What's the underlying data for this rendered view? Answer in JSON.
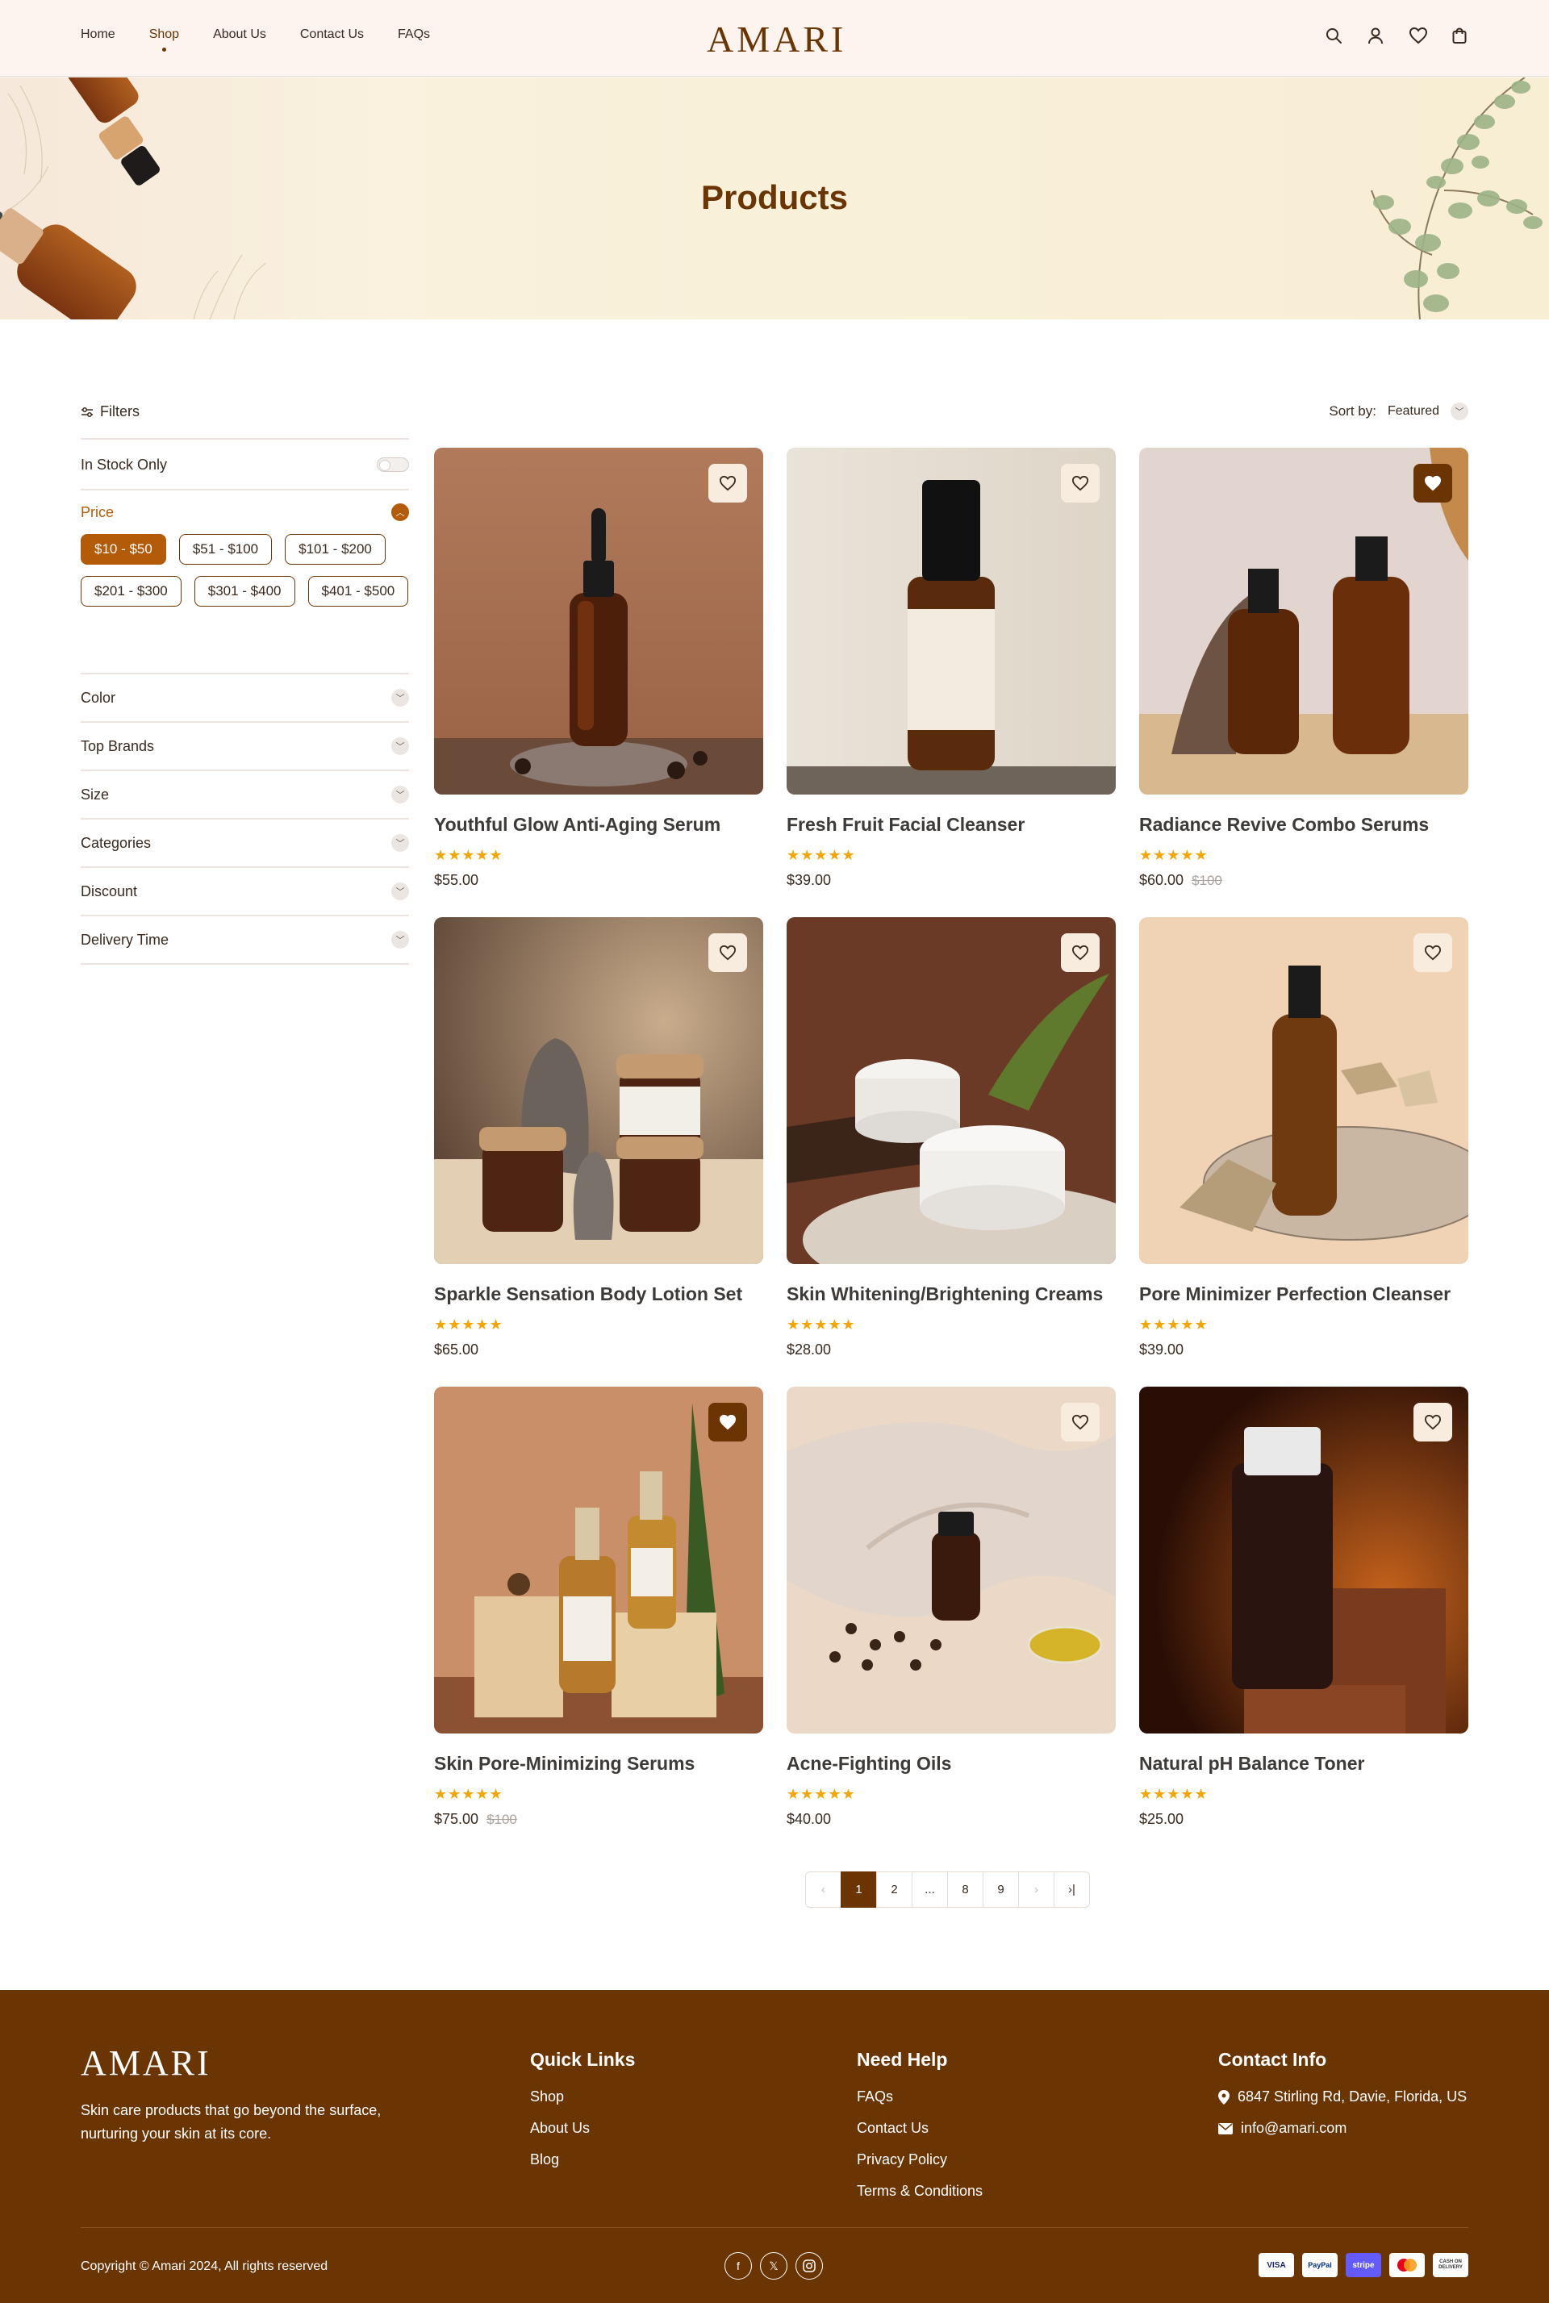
{
  "header": {
    "nav": [
      "Home",
      "Shop",
      "About Us",
      "Contact Us",
      "FAQs"
    ],
    "active_nav": "Shop",
    "logo": "AMARI",
    "icons": [
      "search-icon",
      "user-icon",
      "heart-icon",
      "bag-icon"
    ]
  },
  "hero": {
    "title": "Products"
  },
  "filters": {
    "heading": "Filters",
    "in_stock_label": "In Stock Only",
    "price_label": "Price",
    "price_ranges": [
      "$10 - $50",
      "$51 - $100",
      "$101 - $200",
      "$201 - $300",
      "$301 - $400",
      "$401 - $500"
    ],
    "active_price": "$10 - $50",
    "sections": [
      "Color",
      "Top Brands",
      "Size",
      "Categories",
      "Discount",
      "Delivery Time"
    ]
  },
  "sort": {
    "label": "Sort by:",
    "value": "Featured"
  },
  "products": [
    {
      "name": "Youthful Glow Anti-Aging Serum",
      "price": "$55.00",
      "old_price": "",
      "rating": 5,
      "wishlisted": false
    },
    {
      "name": "Fresh Fruit Facial Cleanser",
      "price": "$39.00",
      "old_price": "",
      "rating": 5,
      "wishlisted": false
    },
    {
      "name": "Radiance Revive Combo Serums",
      "price": "$60.00",
      "old_price": "$100",
      "rating": 5,
      "wishlisted": true
    },
    {
      "name": "Sparkle Sensation Body Lotion Set",
      "price": "$65.00",
      "old_price": "",
      "rating": 5,
      "wishlisted": false
    },
    {
      "name": "Skin Whitening/Brightening Creams",
      "price": "$28.00",
      "old_price": "",
      "rating": 5,
      "wishlisted": false
    },
    {
      "name": "Pore Minimizer Perfection Cleanser",
      "price": "$39.00",
      "old_price": "",
      "rating": 5,
      "wishlisted": false
    },
    {
      "name": "Skin Pore-Minimizing Serums",
      "price": "$75.00",
      "old_price": "$100",
      "rating": 5,
      "wishlisted": true
    },
    {
      "name": "Acne-Fighting Oils",
      "price": "$40.00",
      "old_price": "",
      "rating": 5,
      "wishlisted": false
    },
    {
      "name": "Natural pH Balance Toner",
      "price": "$25.00",
      "old_price": "",
      "rating": 5,
      "wishlisted": false
    }
  ],
  "pagination": {
    "pages": [
      "1",
      "2",
      "...",
      "8",
      "9"
    ],
    "current": "1"
  },
  "footer": {
    "logo": "AMARI",
    "description": "Skin care products that go beyond the surface, nurturing your skin at its core.",
    "quick_links": {
      "title": "Quick Links",
      "items": [
        "Shop",
        "About Us",
        "Blog"
      ]
    },
    "need_help": {
      "title": "Need Help",
      "items": [
        "FAQs",
        "Contact Us",
        "Privacy Policy",
        "Terms & Conditions"
      ]
    },
    "contact": {
      "title": "Contact Info",
      "address": "6847 Stirling Rd, Davie, Florida, US",
      "email": "info@amari.com"
    },
    "copyright": "Copyright © Amari 2024, All rights reserved",
    "social": [
      "facebook-icon",
      "x-icon",
      "instagram-icon"
    ],
    "payments": [
      "VISA",
      "PayPal",
      "stripe",
      "mastercard",
      "CASH ON DELIVERY"
    ]
  },
  "colors": {
    "brand": "#6b3503",
    "accent": "#b35b08",
    "star": "#f5a500",
    "header_bg": "#fdf3ef"
  }
}
